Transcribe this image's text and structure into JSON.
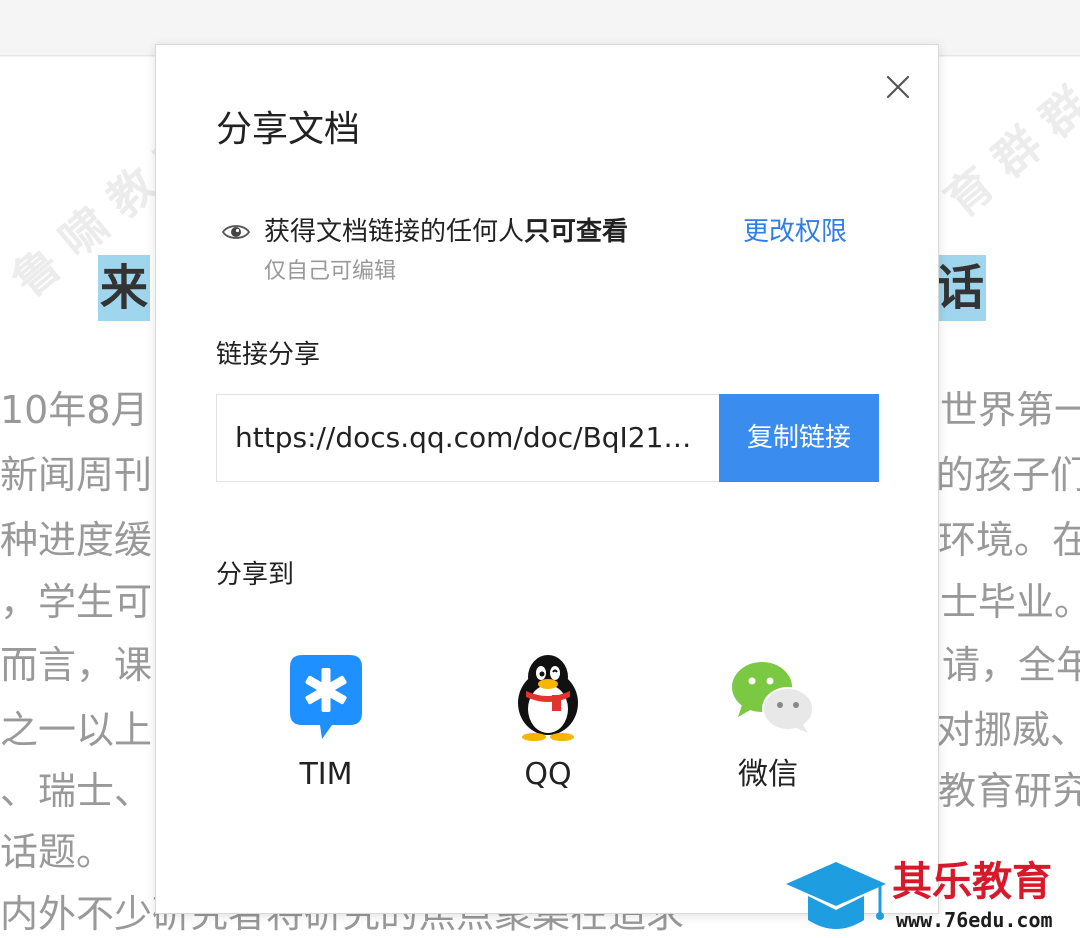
{
  "document": {
    "title_left": "来",
    "title_right": "话",
    "lines": [
      {
        "left": "10年8月",
        "right": "世界第一"
      },
      {
        "left": "新闻周刊",
        "right": "的孩子们"
      },
      {
        "left": "种进度缓",
        "right": "环境。在"
      },
      {
        "left": "，学生可",
        "right": "士毕业。"
      },
      {
        "left": "而言，课",
        "right": "请，全年"
      },
      {
        "left": "之一以上",
        "right": "对挪威、"
      },
      {
        "left": "、瑞士、",
        "right": "教育研究"
      },
      {
        "left": "话题。",
        "right": ""
      },
      {
        "left": "内外不少研究者将研究的焦点聚集在追求",
        "right": ""
      }
    ]
  },
  "dialog": {
    "title": "分享文档",
    "close_icon": "close-icon",
    "permission": {
      "icon": "eye-icon",
      "text_prefix": "获得文档链接的任何人",
      "text_bold": "只可查看",
      "change_label": "更改权限",
      "sub_text": "仅自己可编辑"
    },
    "link_share": {
      "label": "链接分享",
      "url": "https://docs.qq.com/doc/BqI21…",
      "copy_label": "复制链接",
      "copy_color": "#3b8cef"
    },
    "share_to": {
      "label": "分享到",
      "targets": [
        {
          "label": "TIM",
          "icon": "tim-icon",
          "color": "#1e90ff"
        },
        {
          "label": "QQ",
          "icon": "qq-penguin-icon",
          "color": "#000000"
        },
        {
          "label": "微信",
          "icon": "wechat-icon",
          "color": "#7bc843"
        }
      ]
    }
  },
  "branding": {
    "name": "其乐教育",
    "url": "www.76edu.com",
    "icon": "graduation-cap-icon",
    "name_color": "#d8192b",
    "cap_color": "#1e9de0"
  },
  "colors": {
    "accent": "#2f7ee8",
    "highlight": "#9fd6ee"
  }
}
